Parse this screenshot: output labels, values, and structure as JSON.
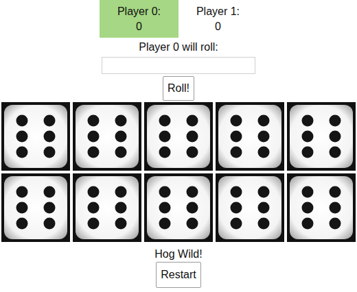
{
  "players": [
    {
      "label": "Player 0:",
      "score": "0",
      "selected": true
    },
    {
      "label": "Player 1:",
      "score": "0",
      "selected": false
    }
  ],
  "prompt": "Player 0 will roll:",
  "roll_input": {
    "value": ""
  },
  "roll_button": "Roll!",
  "dice": [
    {
      "value": 6
    },
    {
      "value": 6
    },
    {
      "value": 6
    },
    {
      "value": 6
    },
    {
      "value": 6
    },
    {
      "value": 6
    },
    {
      "value": 6
    },
    {
      "value": 6
    },
    {
      "value": 6
    },
    {
      "value": 6
    }
  ],
  "status": "Hog Wild!",
  "restart_button": "Restart"
}
